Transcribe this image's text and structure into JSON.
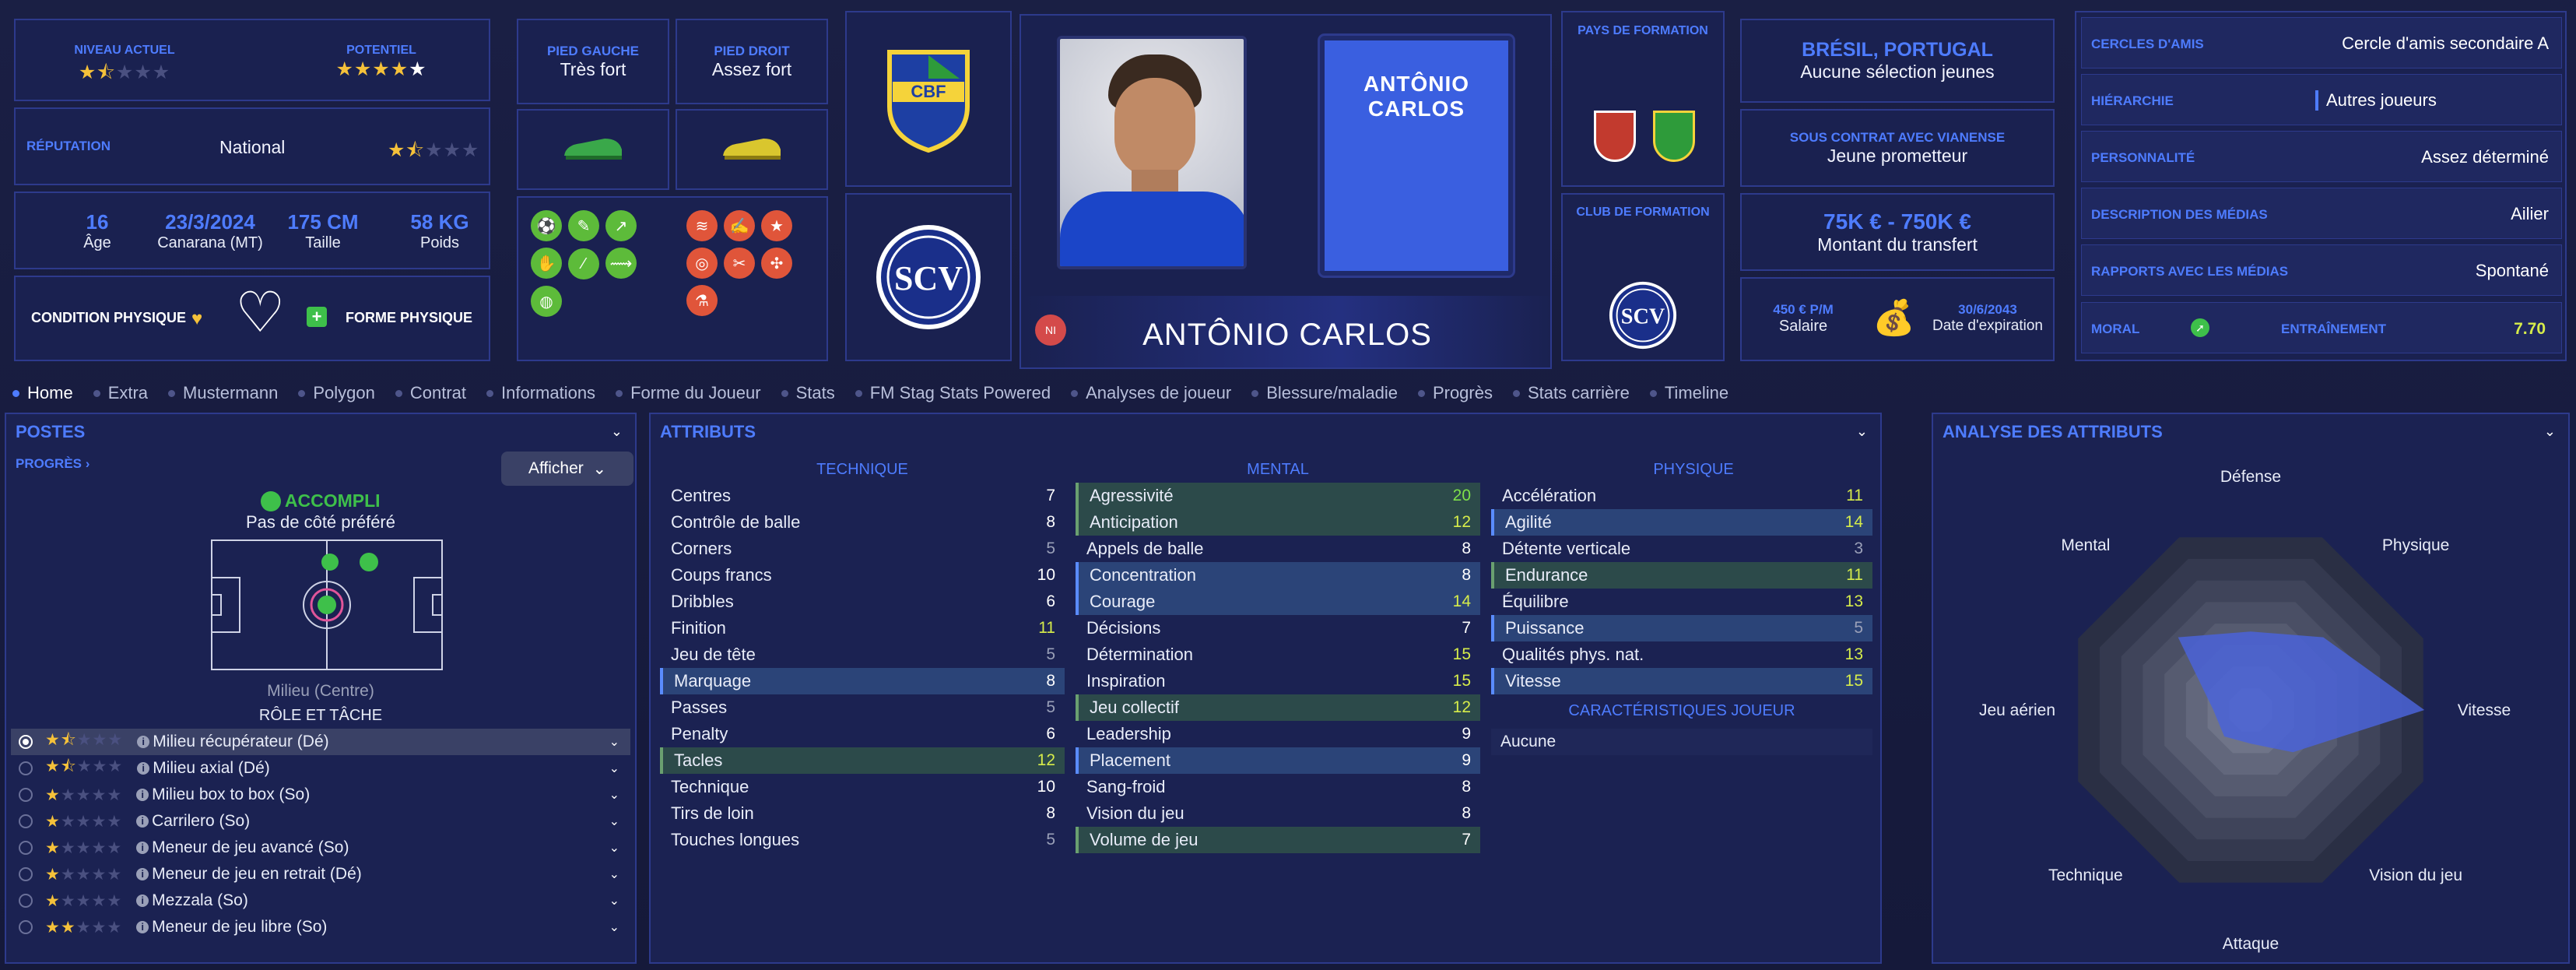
{
  "header": {
    "niveau_label": "NIVEAU ACTUEL",
    "potentiel_label": "POTENTIEL",
    "reputation_label": "RÉPUTATION",
    "reputation_value": "National",
    "age": "16",
    "age_label": "Âge",
    "dob": "23/3/2024",
    "dob_label": "Canarana (MT)",
    "height": "175 CM",
    "height_label": "Taille",
    "weight": "58 KG",
    "weight_label": "Poids",
    "condition_label": "CONDITION PHYSIQUE",
    "forme_label": "FORME PHYSIQUE",
    "left_foot_label": "PIED GAUCHE",
    "left_foot_value": "Très fort",
    "right_foot_label": "PIED DROIT",
    "right_foot_value": "Assez fort",
    "player_name": "ANTÔNIO CARLOS",
    "card_name": "ANTÔNIO CARLOS",
    "ni_badge": "NI",
    "pays_label": "PAYS DE FORMATION",
    "club_label": "CLUB DE FORMATION",
    "nations": "BRÉSIL, PORTUGAL",
    "nations_sub": "Aucune sélection jeunes",
    "contract_label": "SOUS CONTRAT AVEC VIANENSE",
    "contract_value": "Jeune prometteur",
    "transfer_value": "75K € - 750K €",
    "transfer_label": "Montant du transfert",
    "salary_value": "450 € P/M",
    "salary_label": "Salaire",
    "expiry_value": "30/6/2043",
    "expiry_label": "Date d'expiration",
    "right_rows": [
      {
        "label": "CERCLES D'AMIS",
        "value": "Cercle d'amis secondaire A"
      },
      {
        "label": "HIÉRARCHIE",
        "value": "Autres joueurs"
      },
      {
        "label": "PERSONNALITÉ",
        "value": "Assez déterminé"
      },
      {
        "label": "DESCRIPTION DES MÉDIAS",
        "value": "Ailier"
      },
      {
        "label": "RAPPORTS AVEC LES MÉDIAS",
        "value": "Spontané"
      }
    ],
    "moral_label": "MORAL",
    "entrainement_label": "ENTRAÎNEMENT",
    "entrainement_value": "7.70"
  },
  "tabs": [
    "Home",
    "Extra",
    "Mustermann",
    "Polygon",
    "Contrat",
    "Informations",
    "Forme du Joueur",
    "Stats",
    "FM Stag Stats Powered",
    "Analyses de joueur",
    "Blessure/maladie",
    "Progrès",
    "Stats carrière",
    "Timeline"
  ],
  "postes": {
    "title": "POSTES",
    "progres": "PROGRÈS",
    "afficher": "Afficher",
    "accompli": "ACCOMPLI",
    "pref": "Pas de côté préféré",
    "position": "Milieu (Centre)",
    "role_title": "RÔLE ET TÂCHE",
    "roles": [
      "Milieu récupérateur (Dé)",
      "Milieu axial (Dé)",
      "Milieu box to box (So)",
      "Carrilero (So)",
      "Meneur de jeu avancé (So)",
      "Meneur de jeu en retrait (Dé)",
      "Mezzala (So)",
      "Meneur de jeu libre (So)"
    ],
    "role_stars": [
      1.5,
      1.5,
      1,
      1,
      1,
      1,
      1,
      2
    ]
  },
  "attributs": {
    "title": "ATTRIBUTS",
    "technique_title": "TECHNIQUE",
    "mental_title": "MENTAL",
    "physique_title": "PHYSIQUE",
    "technique": [
      [
        "Centres",
        "7"
      ],
      [
        "Contrôle de balle",
        "8"
      ],
      [
        "Corners",
        "5"
      ],
      [
        "Coups francs",
        "10"
      ],
      [
        "Dribbles",
        "6"
      ],
      [
        "Finition",
        "11"
      ],
      [
        "Jeu de tête",
        "5"
      ],
      [
        "Marquage",
        "8"
      ],
      [
        "Passes",
        "5"
      ],
      [
        "Penalty",
        "6"
      ],
      [
        "Tacles",
        "12"
      ],
      [
        "Technique",
        "10"
      ],
      [
        "Tirs de loin",
        "8"
      ],
      [
        "Touches longues",
        "5"
      ]
    ],
    "mental": [
      [
        "Agressivité",
        "20"
      ],
      [
        "Anticipation",
        "12"
      ],
      [
        "Appels de balle",
        "8"
      ],
      [
        "Concentration",
        "8"
      ],
      [
        "Courage",
        "14"
      ],
      [
        "Décisions",
        "7"
      ],
      [
        "Détermination",
        "15"
      ],
      [
        "Inspiration",
        "15"
      ],
      [
        "Jeu collectif",
        "12"
      ],
      [
        "Leadership",
        "9"
      ],
      [
        "Placement",
        "9"
      ],
      [
        "Sang-froid",
        "8"
      ],
      [
        "Vision du jeu",
        "8"
      ],
      [
        "Volume de jeu",
        "7"
      ]
    ],
    "physique": [
      [
        "Accélération",
        "11"
      ],
      [
        "Agilité",
        "14"
      ],
      [
        "Détente verticale",
        "3"
      ],
      [
        "Endurance",
        "11"
      ],
      [
        "Équilibre",
        "13"
      ],
      [
        "Puissance",
        "5"
      ],
      [
        "Qualités phys. nat.",
        "13"
      ],
      [
        "Vitesse",
        "15"
      ]
    ],
    "caract_title": "CARACTÉRISTIQUES JOUEUR",
    "caract_value": "Aucune"
  },
  "analyse": {
    "title": "ANALYSE DES ATTRIBUTS",
    "axes": [
      "Défense",
      "Physique",
      "Vitesse",
      "Vision du jeu",
      "Attaque",
      "Technique",
      "Jeu aérien",
      "Mental"
    ],
    "values": [
      0.42,
      0.55,
      0.93,
      0.32,
      0.18,
      0.2,
      0.2,
      0.55
    ]
  },
  "colors": {
    "accent": "#4e7cff",
    "border": "#2d3a8c",
    "panel": "#1b2252",
    "star": "#f5c13a"
  }
}
